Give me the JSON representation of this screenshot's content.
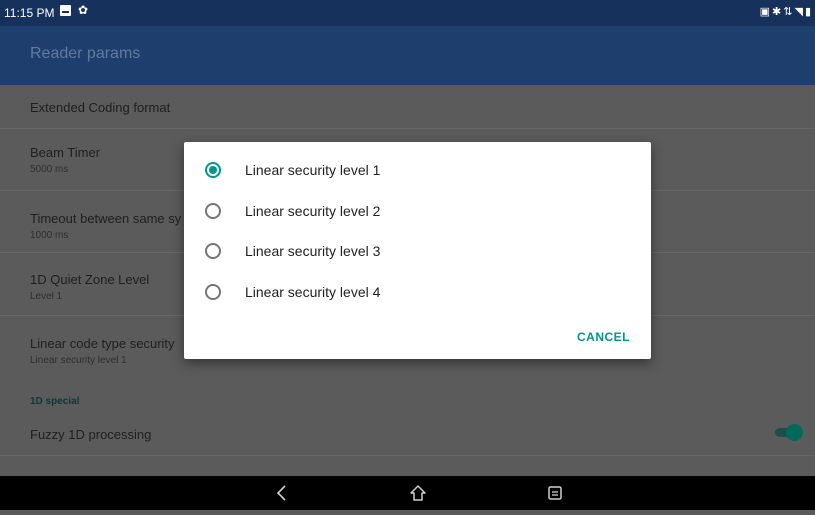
{
  "status_bar": {
    "time": "11:15 PM",
    "icons_left": [
      "image-icon",
      "gear-icon"
    ],
    "icons_right": [
      "screenshot-icon",
      "bluetooth-icon",
      "data-icon",
      "wifi-icon",
      "battery-icon"
    ]
  },
  "app_bar": {
    "title": "Reader params"
  },
  "settings": {
    "items": [
      {
        "title": "Extended Coding format",
        "summary": ""
      },
      {
        "title": "Beam Timer",
        "summary": "5000 ms"
      },
      {
        "title": "Timeout between same sy",
        "summary": "1000 ms"
      },
      {
        "title": "1D Quiet Zone Level",
        "summary": "Level 1"
      },
      {
        "title": "Linear code type security",
        "summary": "Linear security level 1"
      }
    ],
    "section_label": "1D special",
    "fuzzy": {
      "title": "Fuzzy 1D processing",
      "enabled": true
    }
  },
  "dialog": {
    "options": [
      {
        "label": "Linear security level 1",
        "selected": true
      },
      {
        "label": "Linear security level 2",
        "selected": false
      },
      {
        "label": "Linear security level 3",
        "selected": false
      },
      {
        "label": "Linear security level 4",
        "selected": false
      }
    ],
    "cancel_label": "CANCEL"
  },
  "nav_bar": {
    "buttons": [
      "back-icon",
      "home-icon",
      "recent-apps-icon"
    ]
  },
  "colors": {
    "accent": "#009688",
    "app_bar": "#1e3f6d",
    "status_bar": "#16325c"
  }
}
